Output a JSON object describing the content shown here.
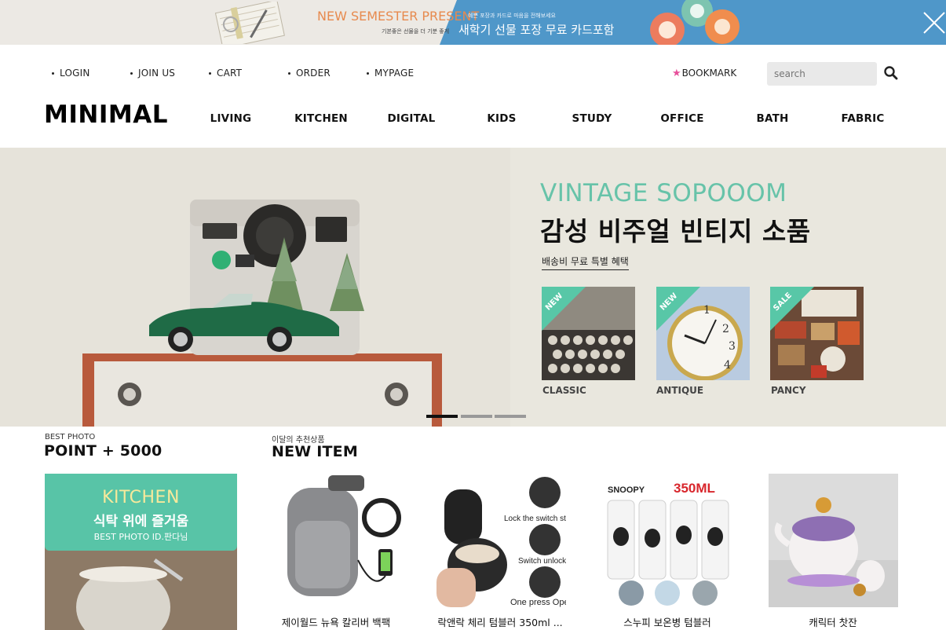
{
  "promo": {
    "title_en": "NEW SEMESTER PRESENT",
    "sub_left": "기본좋은 선물을 더 기분 좋게",
    "sub_right": "예쁜 포장과 카드로 마음을 전해보세요",
    "title_kr": "새학기 선물 포장 무료 카드포함",
    "close_icon": "close-icon",
    "colors": {
      "left_bg": "#ece9e4",
      "right_bg": "#4f97c9",
      "accent": "#e78a4e"
    }
  },
  "util_nav": [
    "LOGIN",
    "JOIN US",
    "CART",
    "ORDER",
    "MYPAGE"
  ],
  "bookmark": {
    "label": "BOOKMARK",
    "icon": "star-icon",
    "color": "#e7509b"
  },
  "search": {
    "placeholder": "search",
    "icon": "search-icon"
  },
  "logo": "MINIMAL",
  "main_nav": [
    "LIVING",
    "KITCHEN",
    "DIGITAL",
    "KIDS",
    "STUDY",
    "OFFICE",
    "BATH",
    "FABRIC"
  ],
  "hero": {
    "title_en": "VINTAGE SOPOOOM",
    "title_kr": "감성 비주얼 빈티지 소품",
    "subtitle": "배송비 무료 특별 혜택",
    "accent": "#67c3a9",
    "thumbs": [
      {
        "badge": "NEW",
        "caption": "CLASSIC"
      },
      {
        "badge": "NEW",
        "caption": "ANTIQUE"
      },
      {
        "badge": "SALE",
        "caption": "PANCY"
      }
    ],
    "pager": {
      "count": 3,
      "active": 1
    }
  },
  "best_photo": {
    "small": "BEST PHOTO",
    "title": "POINT + 5000",
    "card_title_en": "KITCHEN",
    "card_title_kr": "식탁 위에 즐거움",
    "card_credit": "BEST PHOTO  ID.판다님"
  },
  "new_item": {
    "small": "이달의 추천상품",
    "title": "NEW ITEM",
    "products": [
      {
        "name": "제이월드 뉴욕 칼리버 백팩"
      },
      {
        "name": "락앤락 체리 텀블러 350ml ..."
      },
      {
        "name": "스누피 보온병 텀블러",
        "image_text": [
          "SNOOPY",
          "350ML"
        ]
      },
      {
        "name": "캐릭터 찻잔"
      }
    ],
    "tumbler_texts": [
      "Lock the switch state",
      "Switch unlock state",
      "One press Open"
    ]
  }
}
